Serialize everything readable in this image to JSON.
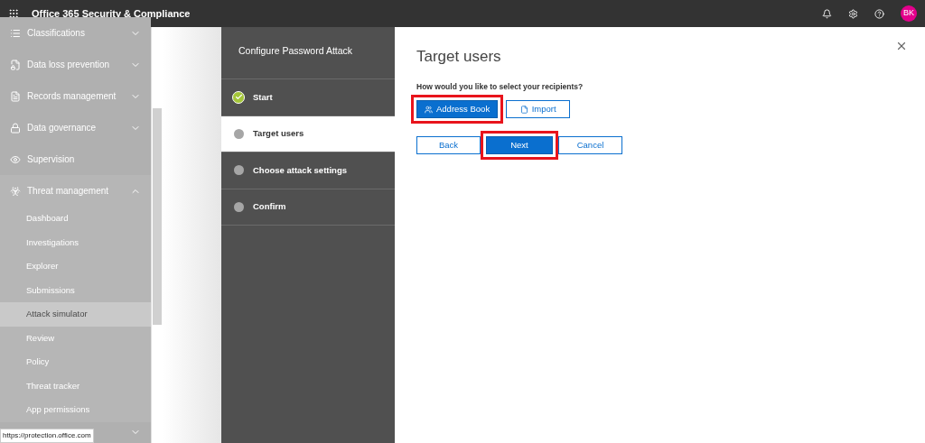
{
  "top_bar": {
    "title": "Office 365 Security & Compliance",
    "avatar": "BK"
  },
  "sidebar": {
    "items": [
      {
        "label": "Classifications",
        "expanded": false
      },
      {
        "label": "Data loss prevention",
        "expanded": false
      },
      {
        "label": "Records management",
        "expanded": false
      },
      {
        "label": "Data governance",
        "expanded": false
      },
      {
        "label": "Supervision"
      },
      {
        "label": "Threat management",
        "expanded": true,
        "children": [
          {
            "label": "Dashboard",
            "selected": false
          },
          {
            "label": "Investigations",
            "selected": false
          },
          {
            "label": "Explorer",
            "selected": false
          },
          {
            "label": "Submissions",
            "selected": false
          },
          {
            "label": "Attack simulator",
            "selected": true
          },
          {
            "label": "Review",
            "selected": false
          },
          {
            "label": "Policy",
            "selected": false
          },
          {
            "label": "Threat tracker",
            "selected": false
          },
          {
            "label": "App permissions",
            "selected": false
          }
        ]
      }
    ]
  },
  "status_tooltip": "https://protection.office.com",
  "wizard": {
    "title": "Configure Password Attack",
    "steps": [
      {
        "label": "Start",
        "selected": false,
        "done": true
      },
      {
        "label": "Target users",
        "selected": true,
        "done": false
      },
      {
        "label": "Choose attack settings",
        "selected": false,
        "done": false
      },
      {
        "label": "Confirm",
        "selected": false,
        "done": false
      }
    ]
  },
  "content": {
    "heading": "Target users",
    "question": "How would you like to select your recipients?",
    "source_buttons": [
      {
        "label": "Address Book",
        "kind": "primary",
        "highlighted": true
      },
      {
        "label": "Import",
        "kind": "secondary",
        "highlighted": false
      }
    ],
    "nav_buttons": [
      {
        "label": "Back",
        "kind": "secondary",
        "highlighted": false
      },
      {
        "label": "Next",
        "kind": "primary",
        "highlighted": true
      },
      {
        "label": "Cancel",
        "kind": "secondary",
        "highlighted": false
      }
    ]
  }
}
